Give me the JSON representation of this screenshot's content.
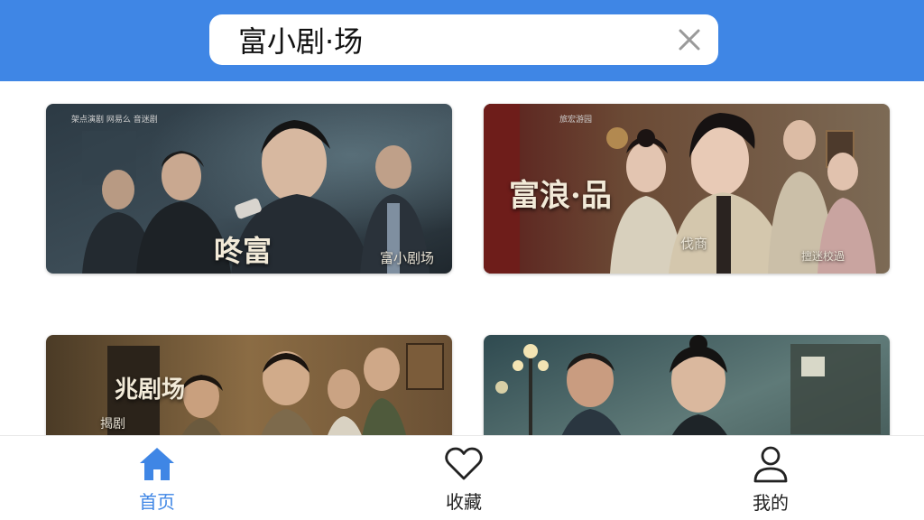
{
  "search": {
    "value": "富小剧·场",
    "clear_icon": "close-icon"
  },
  "cards": [
    {
      "title_big": "咚富",
      "title_small": "富小剧场",
      "credits": "架点演剧   网易么   音迷剧"
    },
    {
      "title_big": "富浪·品",
      "title_small": "伐商",
      "credits": "旅宏游园",
      "badge": "擅迷校過"
    },
    {
      "title_big": "兆剧场",
      "title_small": "揭剧"
    },
    {
      "title_big": "",
      "title_small": ""
    }
  ],
  "nav": {
    "home": {
      "label": "首页",
      "icon": "home-icon"
    },
    "favorites": {
      "label": "收藏",
      "icon": "heart-icon"
    },
    "profile": {
      "label": "我的",
      "icon": "user-icon"
    }
  },
  "colors": {
    "header": "#3f86e5",
    "active": "#3f86e5",
    "text": "#222222"
  }
}
